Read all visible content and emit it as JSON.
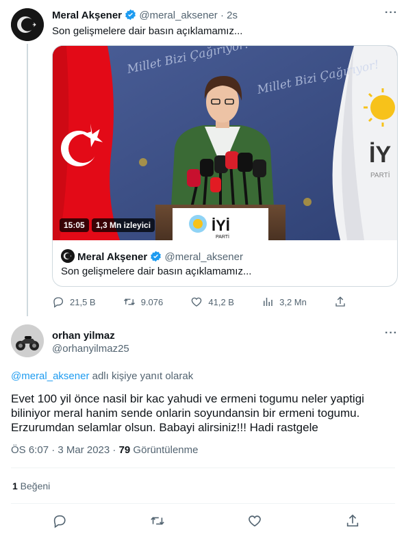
{
  "parent_tweet": {
    "author_name": "Meral Akşener",
    "author_handle": "@meral_aksener",
    "separator": "·",
    "time": "2s",
    "text": "Son gelişmelere dair basın açıklamamız...",
    "video": {
      "duration": "15:05",
      "views": "1,3 Mn izleyici",
      "banner_left": "Millet Bizi Çağırıyor!",
      "banner_right": "Millet Bizi Çağırıyor!",
      "podium_logo": "İYİ",
      "podium_sub": "PARTİ",
      "flag_logo": "İY",
      "flag_sub": "PARTİ"
    },
    "quoted": {
      "author_name": "Meral Akşener",
      "author_handle": "@meral_aksener",
      "text": "Son gelişmelere dair basın açıklamamız..."
    },
    "actions": {
      "replies": "21,5 B",
      "retweets": "9.076",
      "likes": "41,2 B",
      "views": "3,2 Mn"
    }
  },
  "reply_tweet": {
    "author_name": "orhan yilmaz",
    "author_handle": "@orhanyilmaz25",
    "replying_to_handle": "@meral_aksener",
    "replying_to_suffix": " adlı kişiye yanıt olarak",
    "text": "Evet 100 yil önce nasil bir kac yahudi ve ermeni togumu neler yaptigi biliniyor meral hanim sende onlarin soyundansin bir ermeni togumu. Erzurumdan selamlar olsun. Babayi alirsiniz!!! Hadi rastgele",
    "timestamp": "ÖS 6:07 · 3 Mar 2023 · ",
    "view_count": "79",
    "view_label": " Görüntülenme",
    "like_count": "1",
    "like_label": " Beğeni"
  },
  "colors": {
    "accent": "#1d9bf0",
    "muted_text": "#536471",
    "divider": "#eff3f4",
    "flag_red": "#e30a17",
    "iyi_yellow": "#f7c21a",
    "backdrop_blue": "#3b4f86"
  }
}
